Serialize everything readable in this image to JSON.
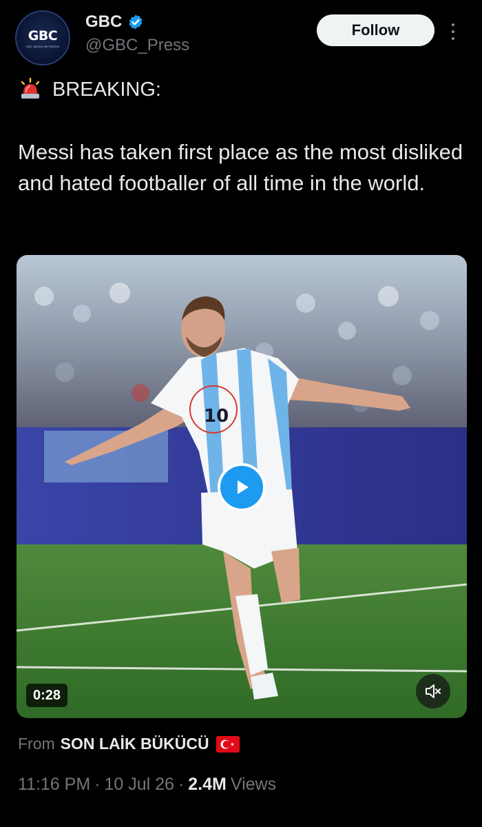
{
  "account": {
    "avatar_text": "GBC",
    "avatar_subtext": "GBC MEDIA NETWORK",
    "display_name": "GBC",
    "handle": "@GBC_Press",
    "verified": true,
    "follow_label": "Follow"
  },
  "post": {
    "breaking_label": "BREAKING:",
    "breaking_icon": "siren-icon",
    "text": "Messi has taken first place as the most disliked and hated footballer of all time in the world.",
    "media": {
      "type": "video",
      "duration": "0:28",
      "play_icon": "play-icon",
      "mute_icon": "mute-icon",
      "jersey_number": "10"
    },
    "source": {
      "prefix": "From",
      "app_name": "SON LAİK BÜKÜCÜ",
      "flag_icon": "turkey-flag-icon"
    },
    "meta": {
      "time": "11:16 PM",
      "date": "10 Jul 26",
      "views_count": "2.4M",
      "views_label": "Views",
      "separator": "·"
    }
  },
  "colors": {
    "background": "#000000",
    "text_primary": "#e7e9ea",
    "text_secondary": "#71767b",
    "accent": "#1d9bf0",
    "follow_bg": "#eff3f4"
  }
}
